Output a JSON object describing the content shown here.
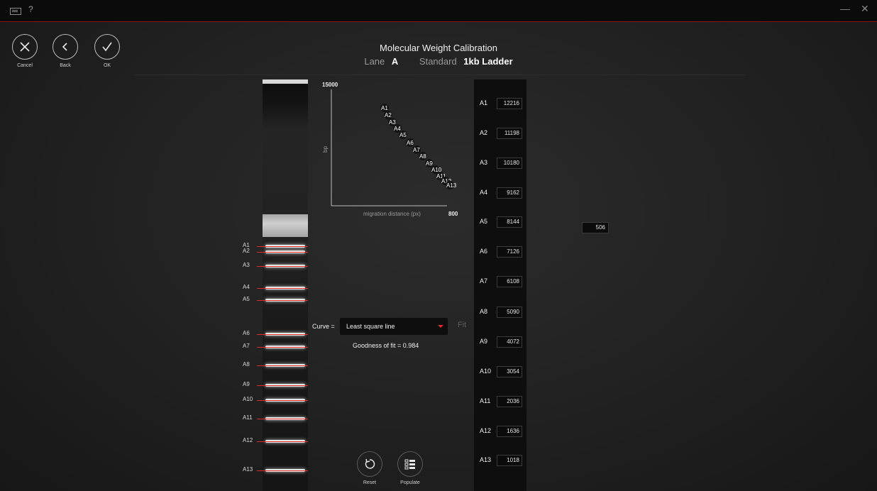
{
  "titlebar": {
    "help": "?",
    "minimize": "—",
    "close": "✕"
  },
  "nav": {
    "cancel": "Cancel",
    "back": "Back",
    "ok": "OK"
  },
  "header": {
    "title": "Molecular Weight Calibration",
    "lane_label": "Lane",
    "lane_value": "A",
    "standard_label": "Standard",
    "standard_value": "1kb Ladder"
  },
  "gel": {
    "bands": [
      "A1",
      "A2",
      "A3",
      "A4",
      "A5",
      "A6",
      "A7",
      "A8",
      "A9",
      "A10",
      "A11",
      "A12",
      "A13"
    ]
  },
  "plot": {
    "y_max": "15000",
    "y_label": "bp",
    "x_label": "migration distance (px)",
    "x_max": "800"
  },
  "curve": {
    "label": "Curve =",
    "selected": "Least square line",
    "fit_button": "Fit",
    "goodness": "Goodness of fit = 0.984"
  },
  "actions": {
    "reset": "Reset",
    "populate": "Populate"
  },
  "table": {
    "rows": [
      {
        "label": "A1",
        "value": "12216"
      },
      {
        "label": "A2",
        "value": "11198"
      },
      {
        "label": "A3",
        "value": "10180"
      },
      {
        "label": "A4",
        "value": "9162"
      },
      {
        "label": "A5",
        "value": "8144"
      },
      {
        "label": "A6",
        "value": "7126"
      },
      {
        "label": "A7",
        "value": "6108"
      },
      {
        "label": "A8",
        "value": "5090"
      },
      {
        "label": "A9",
        "value": "4072"
      },
      {
        "label": "A10",
        "value": "3054"
      },
      {
        "label": "A11",
        "value": "2036"
      },
      {
        "label": "A12",
        "value": "1636"
      },
      {
        "label": "A13",
        "value": "1018"
      }
    ]
  },
  "extra_value": "506",
  "colors": {
    "accent": "#e02a2a",
    "background": "#1c1c1c"
  }
}
